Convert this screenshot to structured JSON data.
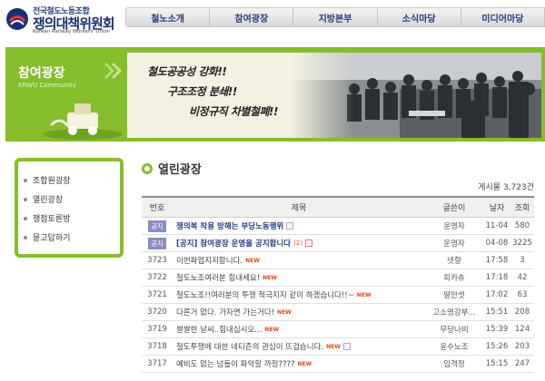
{
  "header": {
    "logo_sub": "전국철도노동조합",
    "logo_main": "쟁의대책위원회",
    "logo_eng": "Korean Railway Workers' Union",
    "nav": [
      {
        "label": "철노소개"
      },
      {
        "label": "참여광장"
      },
      {
        "label": "지방본부"
      },
      {
        "label": "소식마당"
      },
      {
        "label": "미디어마당"
      }
    ]
  },
  "banner": {
    "title": "참여광장",
    "subtitle": "KRWU Community",
    "slogans": [
      "철도공공성 강화!!",
      "구조조정 분쇄!!",
      "비정규직 차별철폐!!"
    ]
  },
  "sidebar": {
    "items": [
      {
        "label": "조합원광장"
      },
      {
        "label": "열린광장"
      },
      {
        "label": "쟁점토론방"
      },
      {
        "label": "묻고답하기"
      }
    ]
  },
  "main": {
    "title": "열린광장",
    "post_count": "게시물 3,723건",
    "columns": {
      "no": "번호",
      "title": "제목",
      "writer": "글쓴이",
      "date": "날자",
      "views": "조회"
    },
    "notices": [
      {
        "badge": "공지",
        "title": "쟁의복 착용 방해는 부당노동행위",
        "writer": "운영자",
        "date": "11-04",
        "views": "580",
        "has_comment": false,
        "icon": true
      },
      {
        "badge": "공지",
        "title": "[공지] 참여광장 운영을 공지합니다",
        "writer": "운영자",
        "date": "04-08",
        "views": "3225",
        "comments": "(2)",
        "icon": true
      }
    ],
    "posts": [
      {
        "no": "3723",
        "title": "이번파업지지합니다.",
        "new_label": "NEW",
        "writer": "넷향",
        "date": "17:58",
        "views": "3"
      },
      {
        "no": "3722",
        "title": "철도노조여러분 힘내세요!",
        "new_label": "NEW",
        "writer": "피카츄",
        "date": "17:18",
        "views": "42"
      },
      {
        "no": "3721",
        "title": "철도노조!!여러분의 투쟁 적극지지 같이 하겠습니다!!~",
        "new_label": "NEW",
        "writer": "딸만셋",
        "date": "17:02",
        "views": "63"
      },
      {
        "no": "3720",
        "title": "다른거 없다. 가자면 가는거다!",
        "new_label": "NEW",
        "writer": "고소영강부...",
        "date": "15:51",
        "views": "208"
      },
      {
        "no": "3719",
        "title": "쌀쌀한 날씨..힘내십시오...",
        "new_label": "NEW",
        "writer": "무당나비",
        "date": "15:39",
        "views": "124"
      },
      {
        "no": "3718",
        "title": "철도투쟁에 대한 네티즌의 관심이 뜨겁습니다.",
        "new_label": "NEW",
        "writer": "윤수노조",
        "date": "15:26",
        "views": "203"
      },
      {
        "no": "3717",
        "title": "예비도 없는 넘들이 파악할 까정????",
        "new_label": "NEW",
        "writer": "임격정",
        "date": "15:15",
        "views": "247"
      }
    ]
  }
}
